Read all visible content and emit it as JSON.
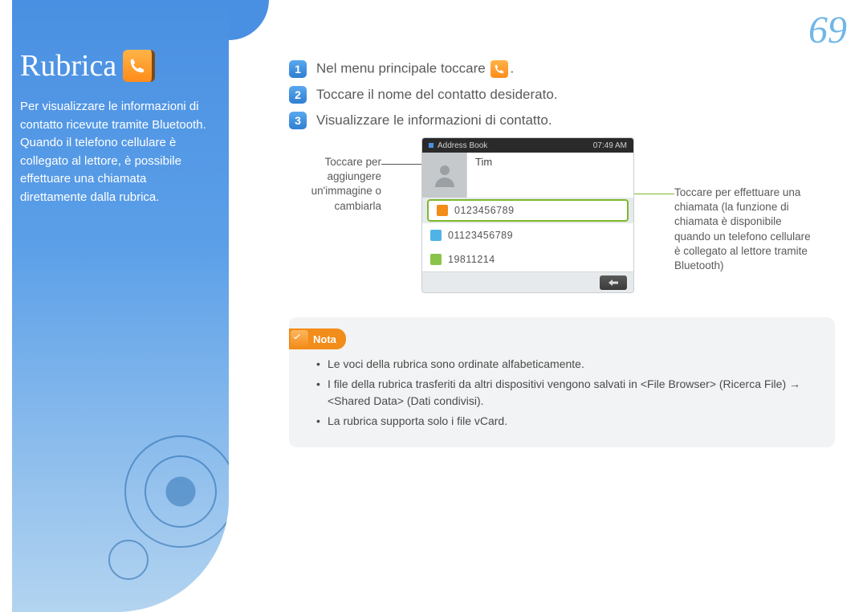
{
  "page_number": "69",
  "sidebar": {
    "title": "Rubrica",
    "description": "Per visualizzare le informazioni di contatto ricevute tramite Bluetooth. Quando il telefono cellulare è collegato al lettore, è possibile effettuare una chiamata direttamente dalla rubrica."
  },
  "steps": {
    "s1": {
      "num": "1",
      "text_before": "Nel menu principale toccare",
      "text_after": "."
    },
    "s2": {
      "num": "2",
      "text": "Toccare il nome del contatto desiderato."
    },
    "s3": {
      "num": "3",
      "text": "Visualizzare le informazioni di contatto."
    }
  },
  "callouts": {
    "left": "Toccare per aggiungere un'immagine o cambiarla",
    "right": "Toccare per effettuare una chiamata (la funzione di chiamata è disponibile quando un telefono cellulare è collegato al lettore tramite Bluetooth)"
  },
  "phone": {
    "title": "Address Book",
    "time": "07:49 AM",
    "contact_name": "Tim",
    "numbers": {
      "mobile": "0123456789",
      "home": "01123456789",
      "birthday": "19811214"
    }
  },
  "note": {
    "label": "Nota",
    "items": [
      "Le voci della rubrica sono ordinate alfabeticamente.",
      "I file della rubrica trasferiti da altri dispositivi vengono salvati in <File Browser> (Ricerca File) → <Shared Data> (Dati condivisi).",
      "La rubrica supporta solo i file vCard."
    ]
  }
}
